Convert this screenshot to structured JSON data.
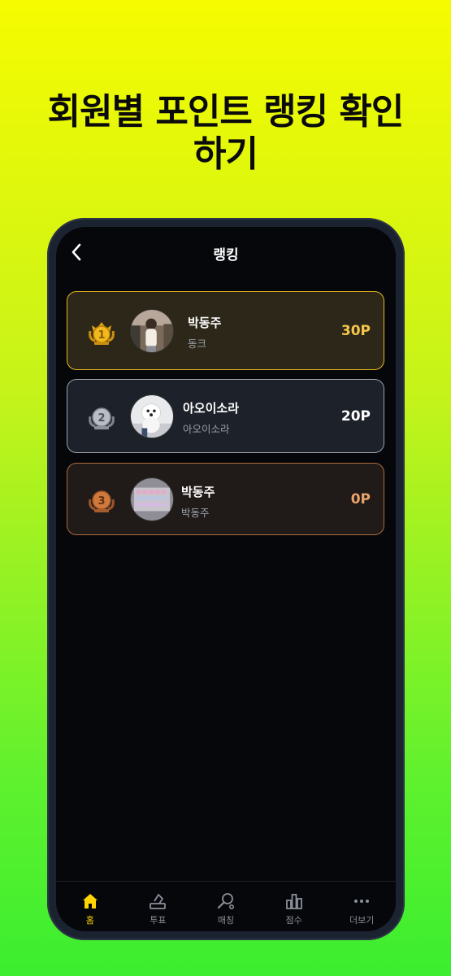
{
  "headline": {
    "line1": "회원별 포인트 랭킹 확인",
    "line2": "하기"
  },
  "screen": {
    "title": "랭킹",
    "back_icon": "chevron-left-icon"
  },
  "ranking": [
    {
      "rank": "1",
      "name": "박동주",
      "subtitle": "동크",
      "points": "30P",
      "tier": "gold",
      "accent": "#e6b81e"
    },
    {
      "rank": "2",
      "name": "아오이소라",
      "subtitle": "아오이소라",
      "points": "20P",
      "tier": "silver",
      "accent": "#9aa0aa"
    },
    {
      "rank": "3",
      "name": "박동주",
      "subtitle": "박동주",
      "points": "0P",
      "tier": "bronze",
      "accent": "#b06a3a"
    }
  ],
  "nav": {
    "items": [
      {
        "label": "홈",
        "icon": "home-icon",
        "active": true
      },
      {
        "label": "투표",
        "icon": "vote-icon",
        "active": false
      },
      {
        "label": "매칭",
        "icon": "racket-icon",
        "active": false
      },
      {
        "label": "점수",
        "icon": "chart-icon",
        "active": false
      },
      {
        "label": "더보기",
        "icon": "more-icon",
        "active": false
      }
    ],
    "active_color": "#ffd400"
  }
}
